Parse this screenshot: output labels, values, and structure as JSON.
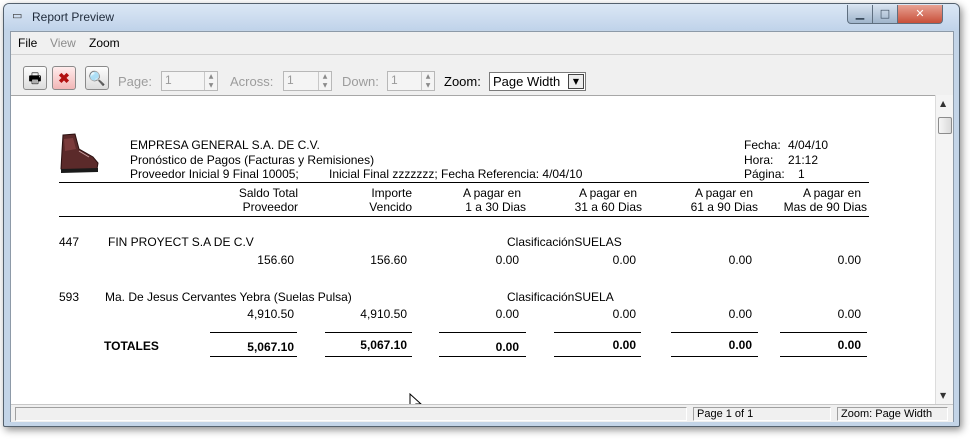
{
  "window": {
    "title": "Report Preview"
  },
  "menu": {
    "file": "File",
    "view": "View",
    "zoom": "Zoom"
  },
  "toolbar": {
    "page_label": "Page:",
    "page_value": "1",
    "across_label": "Across:",
    "across_value": "1",
    "down_label": "Down:",
    "down_value": "1",
    "zoom_label": "Zoom:",
    "zoom_value": "Page Width"
  },
  "report": {
    "company": "EMPRESA GENERAL S.A. DE C.V.",
    "subtitle": "Pronóstico de Pagos (Facturas y Remisiones)",
    "params_left": "Proveedor Inicial 9 Final 10005;",
    "params_mid": "Inicial  Final zzzzzzz;  Fecha Referencia:  4/04/10",
    "fecha_label": "Fecha:",
    "fecha_value": "4/04/10",
    "hora_label": "Hora:",
    "hora_value": "21:12",
    "pagina_label": "Página:",
    "pagina_value": "1",
    "columns": [
      {
        "line1": "Saldo Total",
        "line2": "Proveedor"
      },
      {
        "line1": "Importe",
        "line2": "Vencido"
      },
      {
        "line1": "A pagar en",
        "line2": "1 a 30 Dias"
      },
      {
        "line1": "A pagar en",
        "line2": "31 a 60 Dias"
      },
      {
        "line1": "A pagar en",
        "line2": "61 a 90 Dias"
      },
      {
        "line1": "A pagar en",
        "line2": "Mas de 90 Dias"
      }
    ],
    "rows": [
      {
        "id": "447",
        "name": "FIN PROYECT S.A DE C.V",
        "clasificacion": "ClasificaciónSUELAS",
        "values": [
          "156.60",
          "156.60",
          "0.00",
          "0.00",
          "0.00",
          "0.00"
        ]
      },
      {
        "id": "593",
        "name": "Ma. De Jesus Cervantes Yebra (Suelas Pulsa)",
        "clasificacion": "ClasificaciónSUELA",
        "values": [
          "4,910.50",
          "4,910.50",
          "0.00",
          "0.00",
          "0.00",
          "0.00"
        ]
      }
    ],
    "totals_label": "TOTALES",
    "totals": [
      "5,067.10",
      "5,067.10",
      "0.00",
      "0.00",
      "0.00",
      "0.00"
    ]
  },
  "status": {
    "main": "",
    "page": "Page 1 of 1",
    "zoom": "Zoom: Page Width"
  },
  "icons": [
    "window-menu-icon",
    "print-icon",
    "cancel-icon",
    "find-icon",
    "minimize-icon",
    "maximize-icon",
    "close-icon",
    "shoe-logo",
    "scroll-up-icon",
    "scroll-down-icon",
    "mouse-cursor-icon"
  ]
}
